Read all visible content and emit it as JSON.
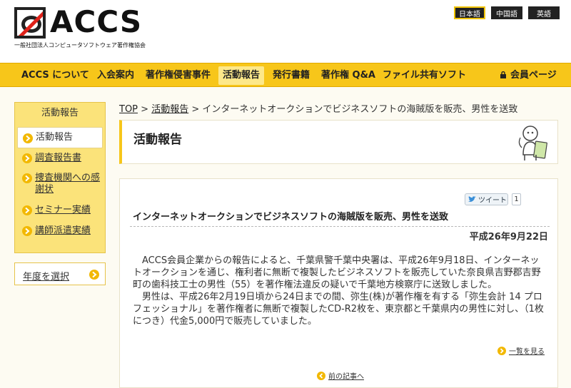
{
  "header": {
    "logo_text": "ACCS",
    "logo_sub": "一般社団法人コンピュータソフトウェア著作権協会",
    "languages": [
      "日本語",
      "中国語",
      "英語"
    ]
  },
  "nav": {
    "items": [
      "ACCS について",
      "入会案内",
      "著作権侵害事件",
      "活動報告",
      "発行書籍",
      "著作権 Q&A",
      "ファイル共有ソフト"
    ],
    "member_page": "会員ページ"
  },
  "sidebar": {
    "title": "活動報告",
    "items": [
      {
        "label": "活動報告"
      },
      {
        "label": "調査報告書"
      },
      {
        "label": "捜査機関への感謝状"
      },
      {
        "label": "セミナー実績"
      },
      {
        "label": "講師派遣実績"
      }
    ],
    "year_select": "年度を選択"
  },
  "breadcrumb": {
    "top": "TOP",
    "sep": ">",
    "section": "活動報告",
    "current": "インターネットオークションでビジネスソフトの海賊版を販売、男性を送致"
  },
  "page_title": "活動報告",
  "article": {
    "tweet_label": "ツイート",
    "tweet_count": "1",
    "heading": "インターネットオークションでビジネスソフトの海賊版を販売、男性を送致",
    "date": "平成26年9月22日",
    "paragraphs": [
      "ACCS会員企業からの報告によると、千葉県警千葉中央署は、平成26年9月18日、インターネットオークションを通じ、権利者に無断で複製したビジネスソフトを販売していた奈良県吉野郡吉野町の歯科技工士の男性（55）を著作権法違反の疑いで千葉地方検察庁に送致しました。",
      "男性は、平成26年2月19日頃から24日までの間、弥生(株)が著作権を有する「弥生会計 14 プロフェッショナル」を著作権者に無断で複製したCD-R2枚を、東京都と千葉県内の男性に対し、（1枚につき）代金5,000円で販売していました。"
    ],
    "list_link": "一覧を見る",
    "prev_link": "前の記事へ"
  }
}
